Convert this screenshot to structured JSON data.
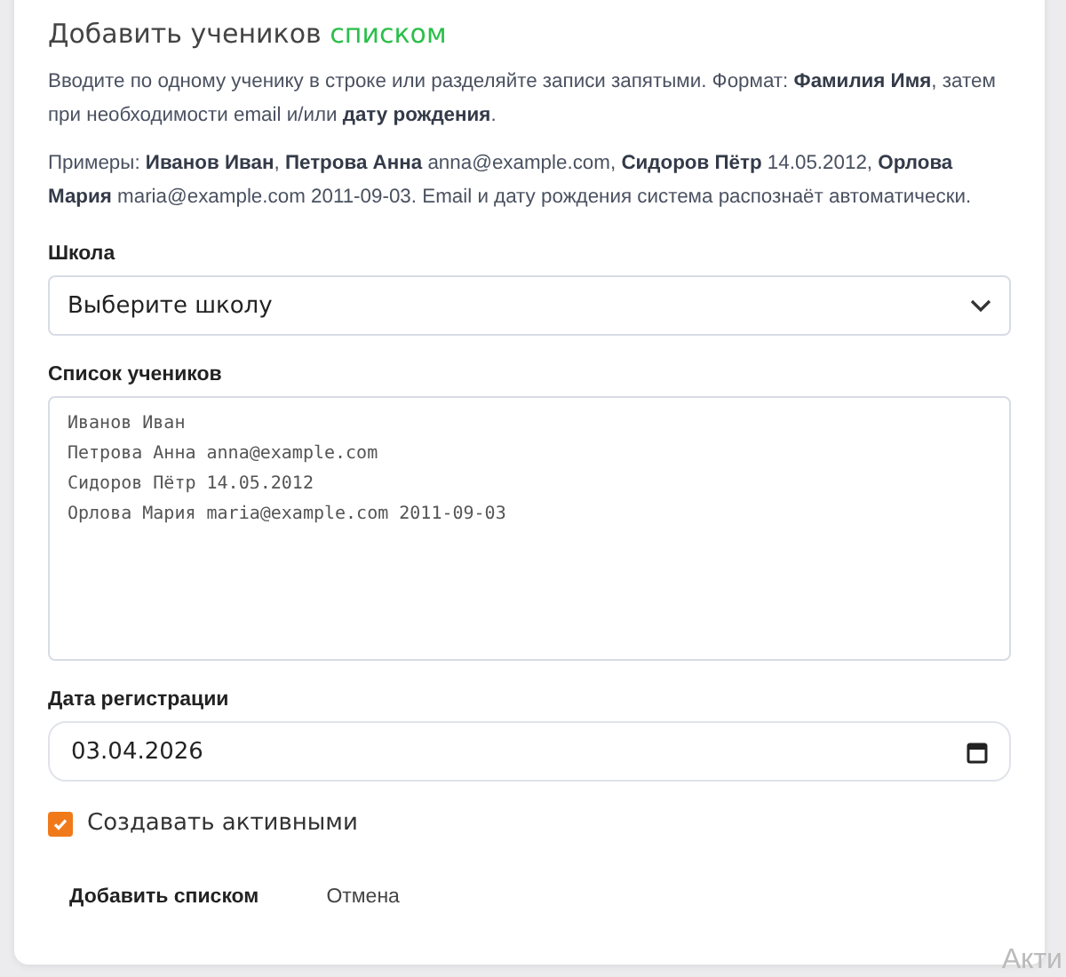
{
  "title": {
    "text": "Добавить учеников",
    "highlight": "списком"
  },
  "description": [
    "Вводите по одному ученику в строке или разделяйте записи запятыми. Формат: **Фамилия Имя**, затем при необходимости email и/или **дату рождения**.",
    "Примеры: **Иванов Иван**, **Петрова Анна** anna@example.com, **Сидоров Пётр** 14.05.2012, **Орлова Мария** maria@example.com 2011-09-03. Email и дату рождения система распознаёт автоматически."
  ],
  "school": {
    "label": "Школа",
    "placeholder": "Выберите школу"
  },
  "student_list": {
    "label": "Список учеников",
    "value": "Иванов Иван\nПетрова Анна anna@example.com\nСидоров Пётр 14.05.2012\nОрлова Мария maria@example.com 2011-09-03"
  },
  "registration_date": {
    "label": "Дата регистрации",
    "value": "03.04.2026"
  },
  "create_active": {
    "label": "Создавать активными",
    "checked": true
  },
  "buttons": [
    "Добавить списком",
    "Отмена"
  ],
  "overlay_text": "Акти"
}
